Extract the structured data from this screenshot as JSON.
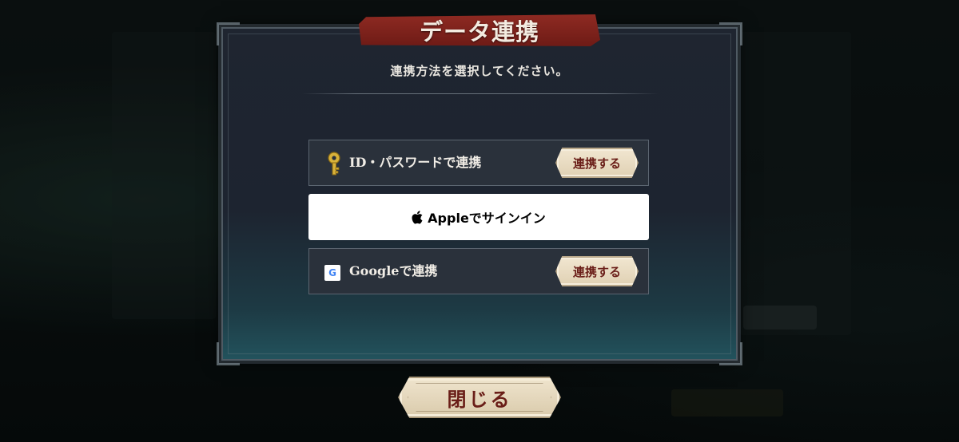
{
  "dialog": {
    "title": "データ連携",
    "subtitle": "連携方法を選択してください。"
  },
  "options": {
    "id_password": {
      "label": "ID・パスワードで連携",
      "icon": "key-icon",
      "button_label": "連携する"
    },
    "apple": {
      "label": "Appleでサインイン",
      "icon": "apple-icon"
    },
    "google": {
      "label": "Googleで連携",
      "icon": "google-icon",
      "icon_glyph": "G",
      "button_label": "連携する"
    }
  },
  "close_button": {
    "label": "閉じる"
  },
  "colors": {
    "ribbon": "#8e2a22",
    "button_text": "#6a1e18",
    "button_bg": "#efe4cd",
    "panel_bg": "#1f2530",
    "row_bg": "#2a313b",
    "key_gold": "#d9b23a"
  }
}
